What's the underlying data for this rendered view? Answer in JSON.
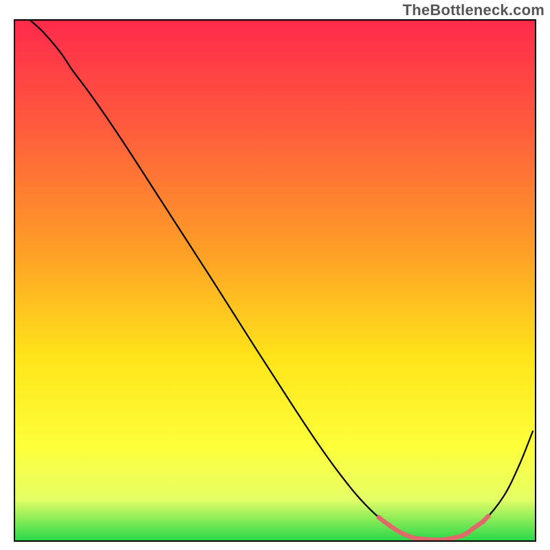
{
  "watermark": "TheBottleneck.com",
  "chart_data": {
    "type": "line",
    "title": "",
    "xlabel": "",
    "ylabel": "",
    "xlim": [
      0,
      100
    ],
    "ylim": [
      0,
      100
    ],
    "gradient_stops": [
      {
        "offset": 0,
        "color": "#ff2a4b"
      },
      {
        "offset": 20,
        "color": "#ff5a3e"
      },
      {
        "offset": 45,
        "color": "#ffa126"
      },
      {
        "offset": 65,
        "color": "#ffe51a"
      },
      {
        "offset": 82,
        "color": "#fdff3a"
      },
      {
        "offset": 92,
        "color": "#e6ff66"
      },
      {
        "offset": 100,
        "color": "#2bd84a"
      }
    ],
    "series": [
      {
        "name": "bottleneck-curve",
        "x": [
          3,
          5,
          7,
          9,
          11,
          14,
          18,
          22,
          26,
          30,
          34,
          38,
          42,
          46,
          50,
          54,
          58,
          62,
          66,
          70,
          74,
          78,
          82,
          86,
          90,
          94,
          97,
          99.6
        ],
        "y": [
          100,
          98.2,
          96,
          93.5,
          90.5,
          86.5,
          80.8,
          74.8,
          68.6,
          62.4,
          56.2,
          50,
          43.7,
          37.4,
          31.2,
          25,
          19,
          13.4,
          8.4,
          4.4,
          1.6,
          0.3,
          0.1,
          0.9,
          3.6,
          8.5,
          14.5,
          21.0
        ]
      },
      {
        "name": "highlight-segment",
        "x": [
          70,
          71,
          72,
          73,
          74,
          75,
          76,
          77,
          78,
          79,
          80,
          81,
          82,
          83,
          84,
          85,
          86,
          87,
          88,
          89,
          90,
          91
        ],
        "y": [
          4.4,
          3.6,
          2.9,
          2.2,
          1.6,
          1.1,
          0.7,
          0.4,
          0.3,
          0.2,
          0.1,
          0.1,
          0.1,
          0.2,
          0.4,
          0.6,
          0.9,
          1.4,
          2.2,
          2.9,
          3.6,
          4.6
        ]
      }
    ]
  }
}
